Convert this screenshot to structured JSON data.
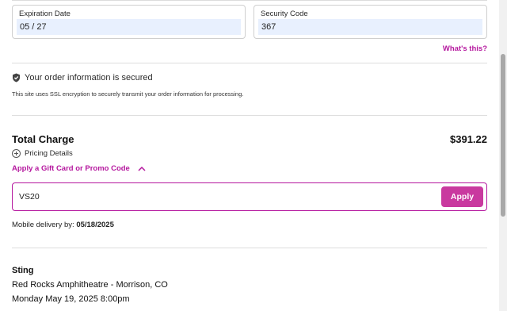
{
  "card": {
    "expiration_label": "Expiration Date",
    "expiration_value": "05 / 27",
    "security_label": "Security Code",
    "security_value": "367",
    "whats_this": "What's this?"
  },
  "security": {
    "icon": "shield-icon",
    "title": "Your order information is secured",
    "text": "This site uses SSL encryption to securely transmit your order information for processing."
  },
  "total": {
    "label": "Total Charge",
    "amount": "$391.22",
    "pricing_details": "Pricing Details",
    "promo_toggle": "Apply a Gift Card or Promo Code"
  },
  "promo": {
    "value": "VS20",
    "apply_label": "Apply"
  },
  "delivery": {
    "label": "Mobile delivery by:",
    "date": "05/18/2025"
  },
  "event": {
    "title": "Sting",
    "venue": "Red Rocks Amphitheatre - Morrison, CO",
    "date": "Monday May 19, 2025 8:00pm"
  },
  "colors": {
    "accent": "#b5179e",
    "button": "#c9399f",
    "autofill": "#e8f0fe"
  }
}
